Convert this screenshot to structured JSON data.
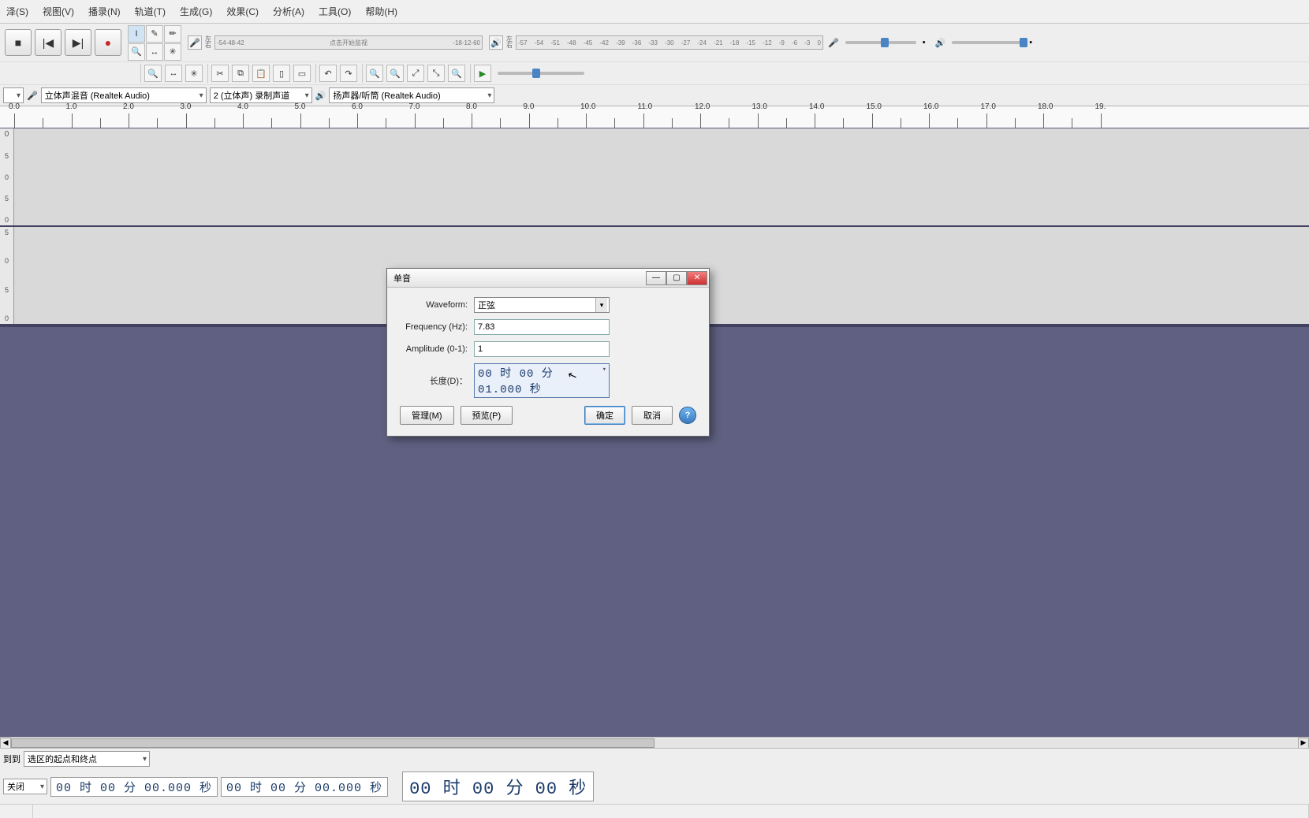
{
  "menu": {
    "items": [
      "泽(S)",
      "视图(V)",
      "播录(N)",
      "轨道(T)",
      "生成(G)",
      "效果(C)",
      "分析(A)",
      "工具(O)",
      "帮助(H)"
    ]
  },
  "transport": {
    "stop": "■",
    "skip_start": "|◀",
    "skip_end": "▶|",
    "record": "●"
  },
  "tools": {
    "selection": "I",
    "envelope": "✎",
    "draw": "✏",
    "zoom": "🔍",
    "timeshift": "↔",
    "multi": "✳"
  },
  "meters": {
    "rec_hint": "点击开始监视",
    "rec_ticks": [
      "-54",
      "-48",
      "-42",
      "",
      "-18",
      "-12",
      "-6",
      "0"
    ],
    "play_ticks": [
      "-57",
      "-54",
      "-51",
      "-48",
      "-45",
      "-42",
      "-39",
      "-36",
      "-33",
      "-30",
      "-27",
      "-24",
      "-21",
      "-18",
      "-15",
      "-12",
      "-9",
      "-6",
      "-3",
      "0"
    ]
  },
  "edit_icons": {
    "cut": "✂",
    "copy": "⧉",
    "paste": "📋",
    "trim": "▯",
    "silence": "▭",
    "undo": "↶",
    "redo": "↷",
    "zoom_in": "🔍+",
    "zoom_out": "🔍-",
    "fit_sel": "⤢",
    "fit_proj": "⤡",
    "zoom_toggle": "🔍",
    "play_region": "▶"
  },
  "devices": {
    "host_dd": "",
    "input": "立体声混音 (Realtek Audio)",
    "channels": "2 (立体声) 录制声道",
    "output": "扬声器/听筒 (Realtek Audio)"
  },
  "ruler": {
    "labels": [
      "0.0",
      "1.0",
      "2.0",
      "3.0",
      "4.0",
      "5.0",
      "6.0",
      "7.0",
      "8.0",
      "9.0",
      "10.0",
      "11.0",
      "12.0",
      "13.0",
      "14.0",
      "15.0",
      "16.0",
      "17.0",
      "18.0",
      "19."
    ]
  },
  "track": {
    "scale": [
      "0",
      "5",
      "0",
      "5",
      "0"
    ]
  },
  "selection_bar": {
    "snapto": "到到",
    "mode": "选区的起点和终点",
    "closed": "关闭",
    "time1": "00 时 00 分 00.000 秒",
    "time2": "00 时 00 分 00.000 秒",
    "bigtime": "00 时 00 分 00 秒"
  },
  "dialog": {
    "title": "单音",
    "waveform_label": "Waveform:",
    "waveform_value": "正弦",
    "freq_label": "Frequency (Hz):",
    "freq_value": "7.83",
    "amp_label": "Amplitude (0-1):",
    "amp_value": "1",
    "dur_label": "长度(D)：",
    "dur_value": "00 时 00 分 01.000 秒",
    "manage": "管理(M)",
    "preview": "预览(P)",
    "ok": "确定",
    "cancel": "取消"
  }
}
